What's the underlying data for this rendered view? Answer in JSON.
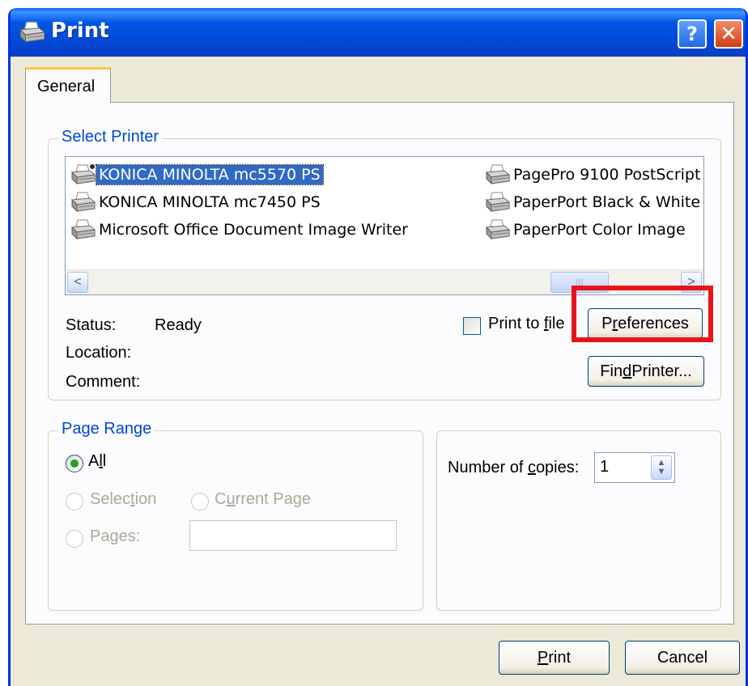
{
  "window": {
    "title": "Print",
    "help_glyph": "?",
    "close_glyph": "✕"
  },
  "tabs": [
    {
      "label": "General",
      "selected": true
    }
  ],
  "select_printer": {
    "label": "Select Printer",
    "printers": [
      {
        "name": "KONICA MINOLTA mc5570 PS",
        "selected": true,
        "default": true
      },
      {
        "name": "KONICA MINOLTA mc7450 PS",
        "selected": false
      },
      {
        "name": "Microsoft Office Document Image Writer",
        "selected": false
      },
      {
        "name": "PagePro 9100 PostScript",
        "selected": false
      },
      {
        "name": "PaperPort Black & White",
        "selected": false
      },
      {
        "name": "PaperPort Color Image",
        "selected": false
      }
    ],
    "scroll_left": "<",
    "scroll_right": ">",
    "thumb_grip": "|||",
    "status_label": "Status:",
    "status_value": "Ready",
    "location_label": "Location:",
    "location_value": "",
    "comment_label": "Comment:",
    "comment_value": "",
    "print_to_file": {
      "label_pre": "Print to ",
      "label_u": "f",
      "label_post": "ile",
      "checked": false
    },
    "preferences_button": {
      "pre": "P",
      "u": "r",
      "post": "eferences"
    },
    "find_printer_button": {
      "pre": "Fin",
      "u": "d",
      "post": " Printer..."
    }
  },
  "page_range": {
    "label": "Page Range",
    "all": {
      "pre": "A",
      "u": "l",
      "post": "l",
      "checked": true
    },
    "selection": {
      "pre": "Selec",
      "u": "t",
      "post": "ion",
      "enabled": false
    },
    "current_page": {
      "pre": "C",
      "u": "u",
      "post": "rrent Page",
      "enabled": false
    },
    "pages": {
      "pre": "Pa",
      "u": "g",
      "post": "es:",
      "enabled": false,
      "value": ""
    }
  },
  "copies": {
    "label_pre": "Number of ",
    "label_u": "c",
    "label_post": "opies:",
    "value": "1",
    "spin_up": "▲",
    "spin_down": "▼"
  },
  "footer": {
    "print_button": {
      "u": "P",
      "post": "rint"
    },
    "cancel_button": "Cancel"
  },
  "colors": {
    "accent": "#0046d5",
    "title_bar": "#0055e5",
    "highlight": "#e8141c",
    "selection": "#316ac5"
  }
}
